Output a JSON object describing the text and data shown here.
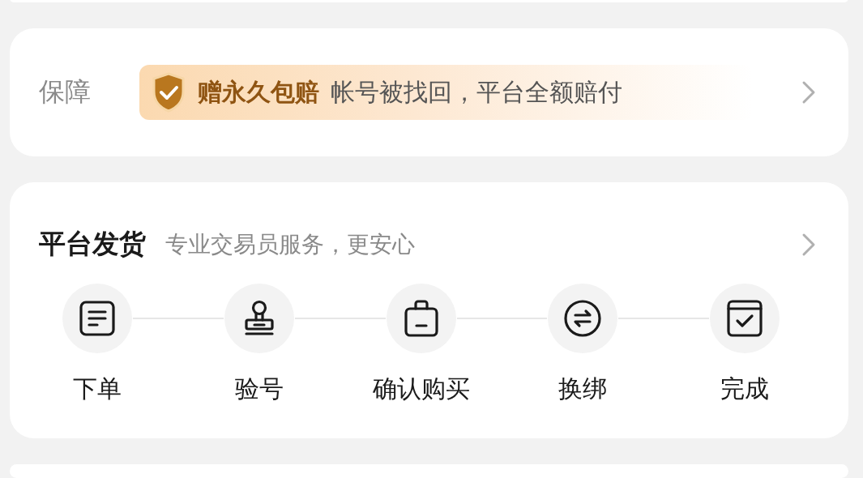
{
  "guarantee": {
    "label": "保障",
    "badge_title": "赠永久包赔",
    "badge_text": "帐号被找回，平台全额赔付"
  },
  "delivery": {
    "title": "平台发货",
    "subtitle": "专业交易员服务，更安心",
    "steps": [
      {
        "kind": "document",
        "label": "下单"
      },
      {
        "kind": "stamp",
        "label": "验号"
      },
      {
        "kind": "bag",
        "label": "确认购买"
      },
      {
        "kind": "swap",
        "label": "换绑"
      },
      {
        "kind": "check",
        "label": "完成"
      }
    ]
  }
}
